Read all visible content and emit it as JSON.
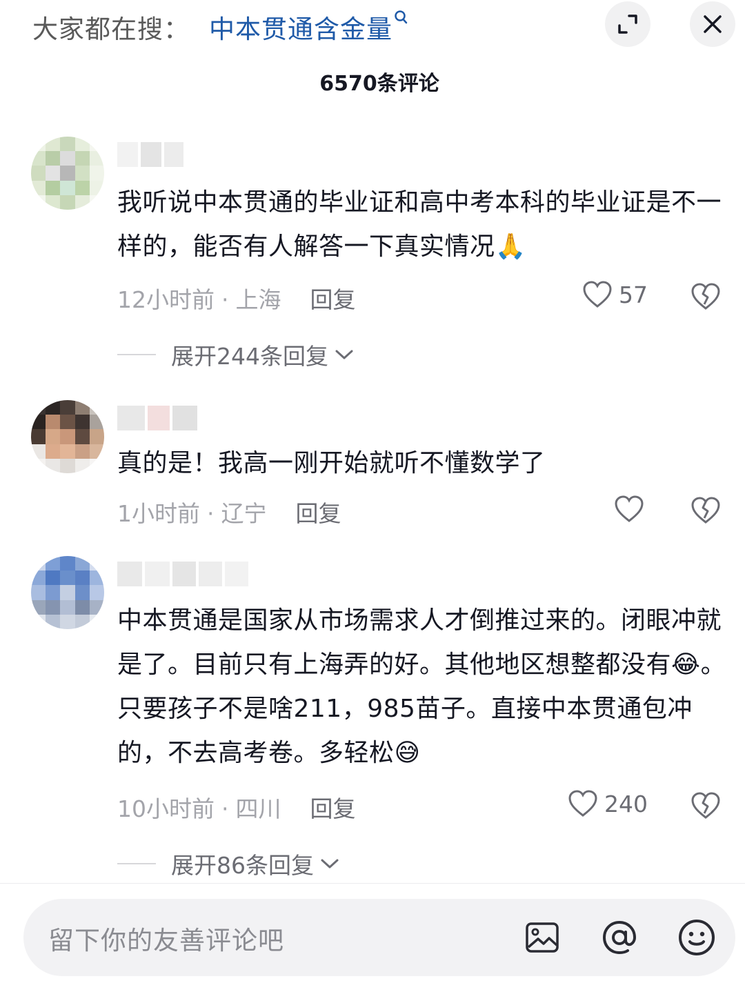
{
  "header": {
    "search_prefix": "大家都在搜：",
    "search_term": "中本贯通含金量",
    "search_term_icon": "search-icon",
    "expand_icon": "expand-icon",
    "close_icon": "close-icon",
    "comment_count": "6570条评论"
  },
  "comments": [
    {
      "text": "我听说中本贯通的毕业证和高中考本科的毕业证是不一样的，能否有人解答一下真实情况🙏",
      "time": "12小时前",
      "location": "上海",
      "reply_label": "回复",
      "like_count": "57",
      "expand_label": "展开244条回复"
    },
    {
      "text": "真的是！我高一刚开始就听不懂数学了",
      "time": "1小时前",
      "location": "辽宁",
      "reply_label": "回复",
      "like_count": ""
    },
    {
      "text": "中本贯通是国家从市场需求人才倒推过来的。闭眼冲就是了。目前只有上海弄的好。其他地区想整都没有😂。只要孩子不是啥211，985苗子。直接中本贯通包冲的，不去高考卷。多轻松😅",
      "time": "10小时前",
      "location": "四川",
      "reply_label": "回复",
      "like_count": "240",
      "expand_label": "展开86条回复"
    }
  ],
  "footer": {
    "input_placeholder": "留下你的友善评论吧",
    "icons": [
      "image-icon",
      "at-icon",
      "emoji-icon"
    ]
  },
  "colors": {
    "search_term": "#1f5aa8",
    "meta": "#a3a4aa",
    "input_bg": "#f2f2f4"
  }
}
